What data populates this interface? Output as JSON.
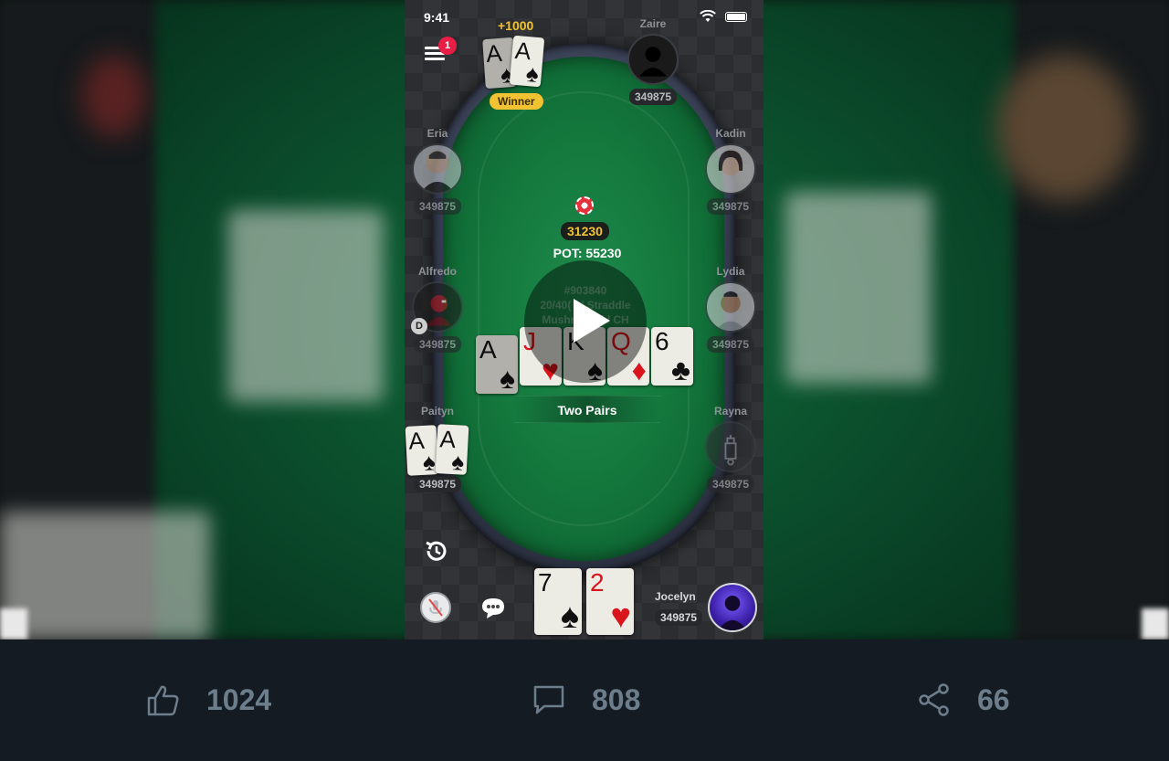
{
  "status_bar": {
    "time": "9:41"
  },
  "menu": {
    "badge_count": "1"
  },
  "winner": {
    "amount": "+1000",
    "label": "Winner",
    "cards": [
      {
        "rank": "A",
        "suit": "♠"
      },
      {
        "rank": "A",
        "suit": "♠"
      }
    ]
  },
  "players": {
    "zaire": {
      "name": "Zaire",
      "stack": "349875"
    },
    "eria": {
      "name": "Eria",
      "stack": "349875"
    },
    "kadin": {
      "name": "Kadin",
      "stack": "349875"
    },
    "alfredo": {
      "name": "Alfredo",
      "stack": "349875",
      "dealer": "D"
    },
    "lydia": {
      "name": "Lydia",
      "stack": "349875"
    },
    "paityn": {
      "name": "Paityn",
      "stack": "349875",
      "cards": [
        {
          "rank": "A",
          "suit": "♠"
        },
        {
          "rank": "A",
          "suit": "♠"
        }
      ]
    },
    "rayna": {
      "name": "Rayna",
      "stack": "349875"
    },
    "jocelyn": {
      "name": "Jocelyn",
      "stack": "349875"
    }
  },
  "table": {
    "bet": "31230",
    "pot": "POT: 55230",
    "info_line1": "#903840",
    "info_line2": "20/40( ) / Straddle",
    "info_line3": "Mushroo...d / CH",
    "hand_rank": "Two Pairs",
    "board": [
      {
        "rank": "A",
        "suit": "♠",
        "color": "black"
      },
      {
        "rank": "J",
        "suit": "♥",
        "color": "red"
      },
      {
        "rank": "K",
        "suit": "♠",
        "color": "black"
      },
      {
        "rank": "Q",
        "suit": "♦",
        "color": "red"
      },
      {
        "rank": "6",
        "suit": "♣",
        "color": "black"
      }
    ],
    "hero_cards": [
      {
        "rank": "7",
        "suit": "♠",
        "color": "black"
      },
      {
        "rank": "2",
        "suit": "♥",
        "color": "red"
      }
    ]
  },
  "engagement": {
    "likes": "1024",
    "comments": "808",
    "shares": "66"
  },
  "icons": {
    "like": "thumbs-up-icon",
    "comment": "speech-bubble-icon",
    "share": "share-icon",
    "play": "play-icon",
    "history": "history-icon",
    "mic": "mic-muted-icon",
    "chat": "chat-icon"
  },
  "colors": {
    "accent_gold": "#f1c232",
    "felt_green": "#147a3e",
    "badge_red": "#e91e46",
    "bottom_bar": "#151b22",
    "action_gray": "#6c7d8c"
  }
}
